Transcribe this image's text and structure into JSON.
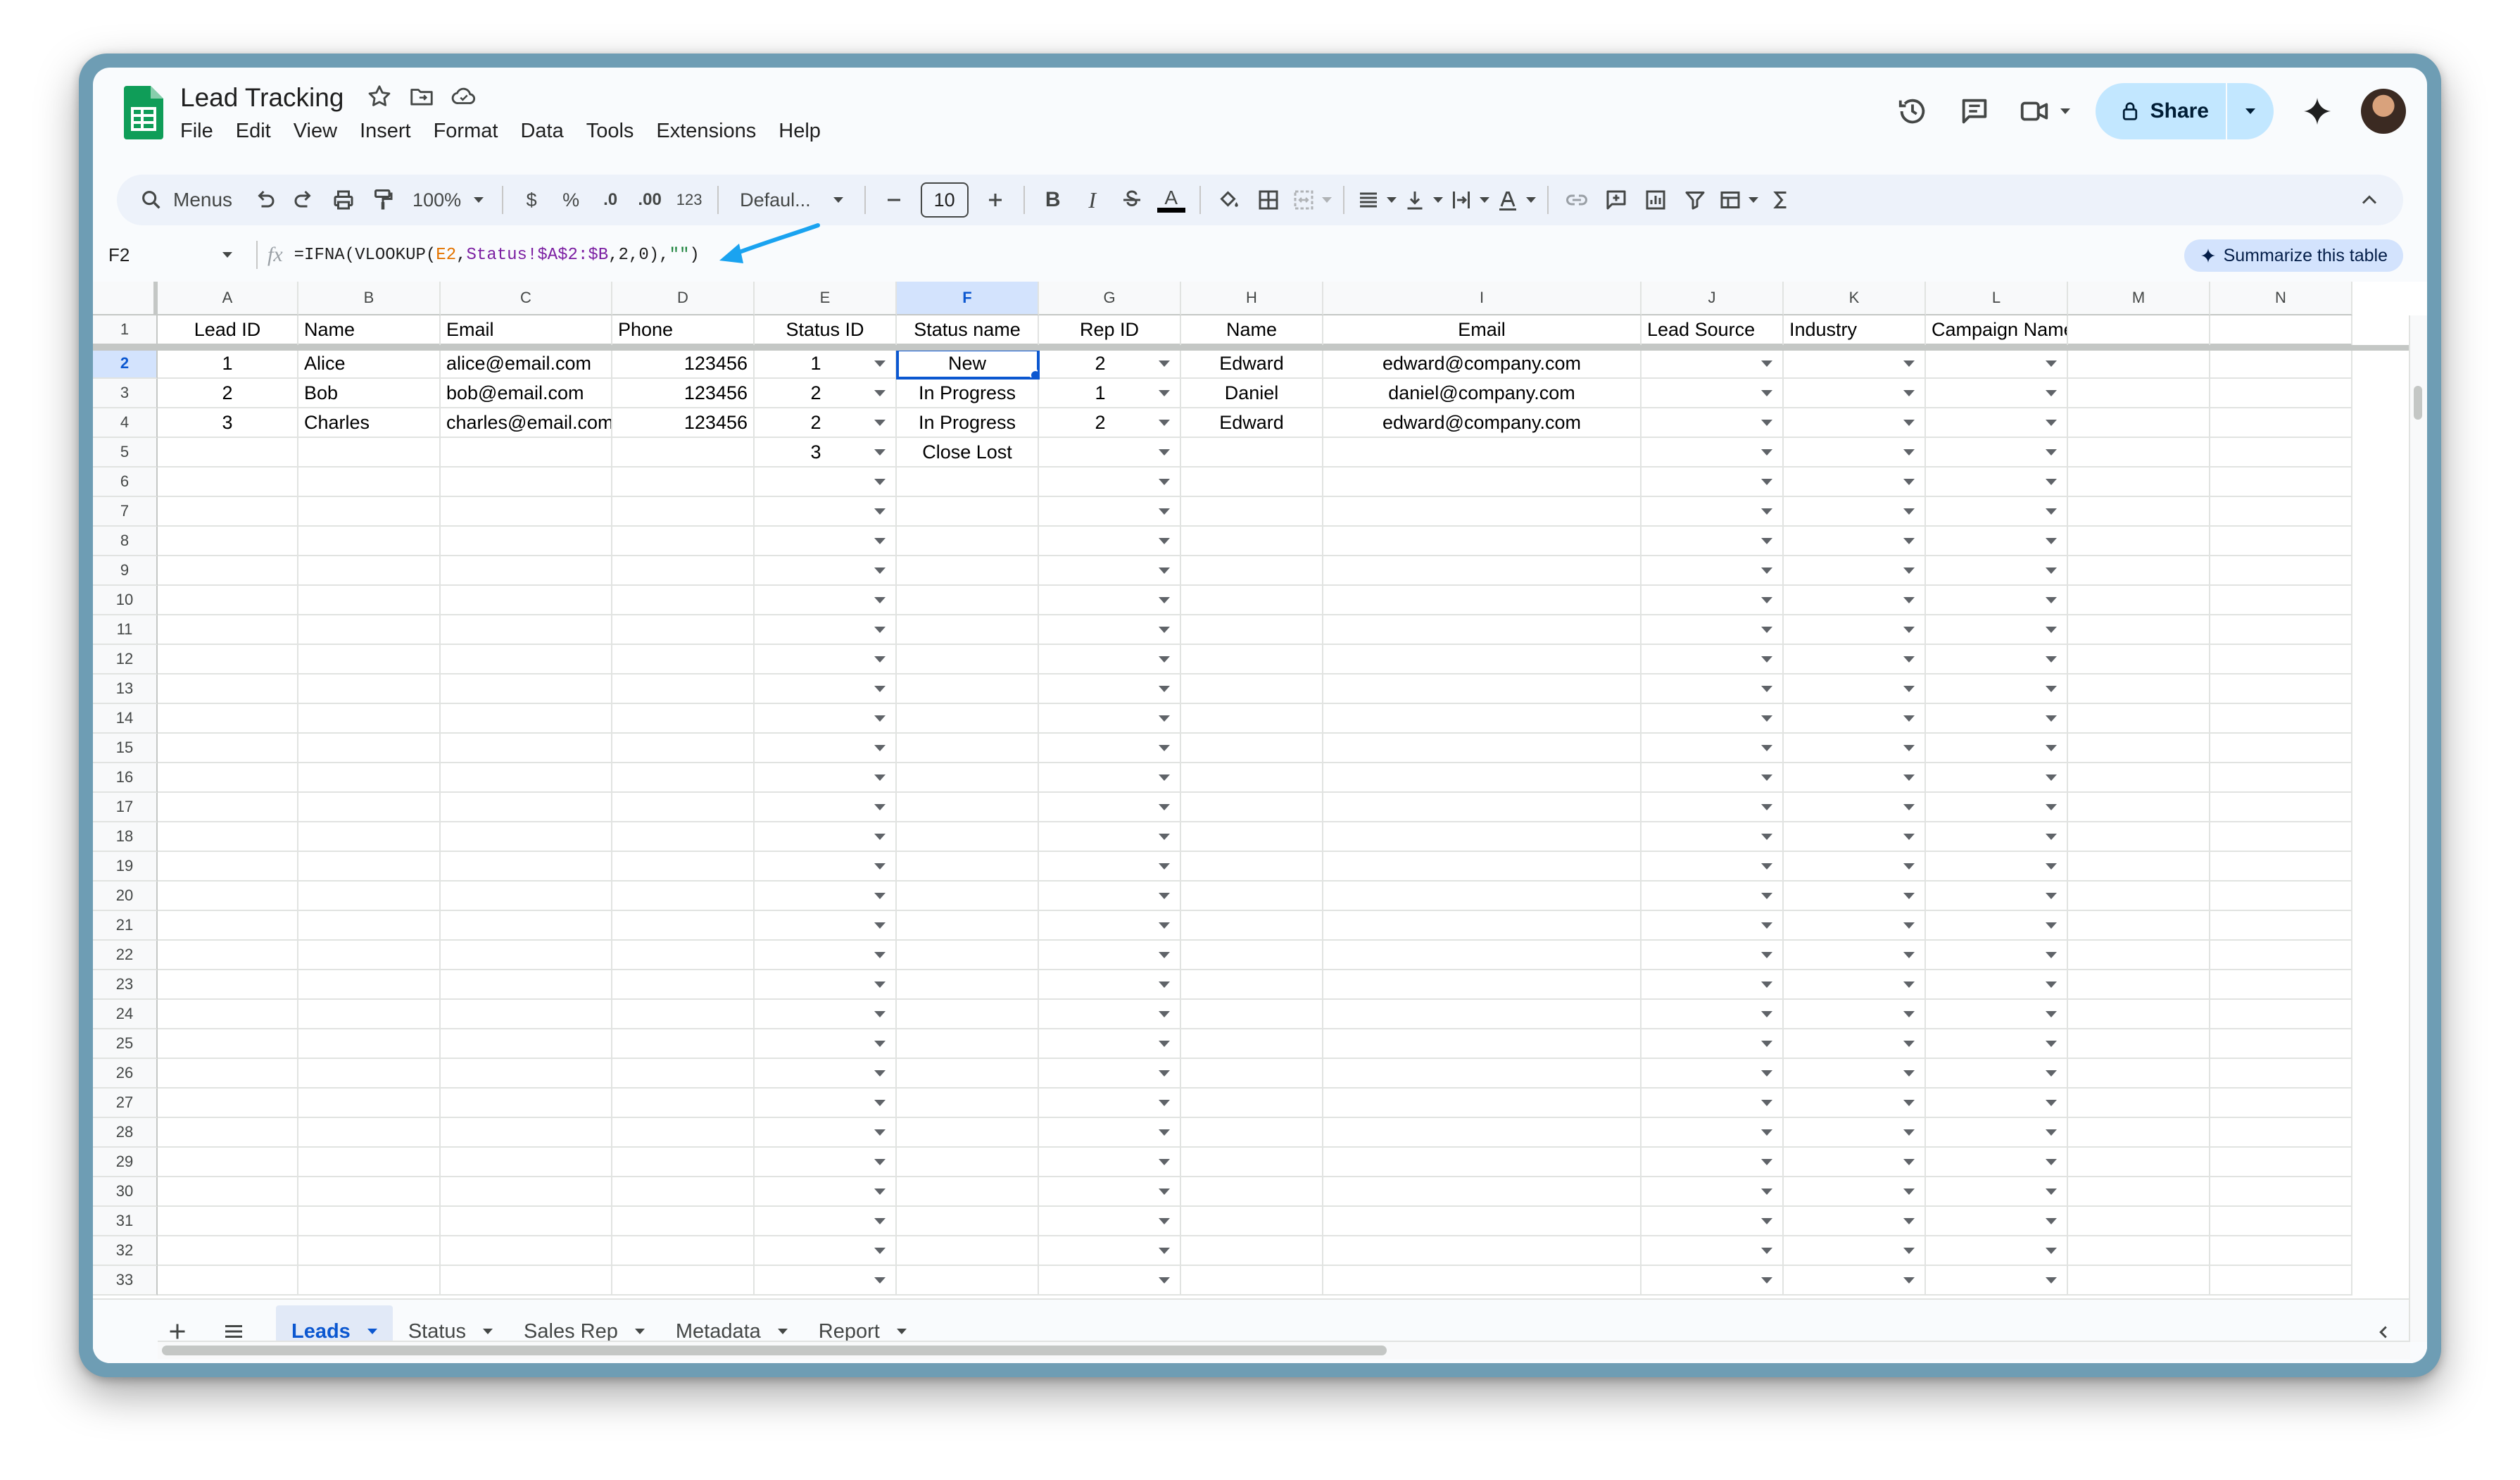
{
  "app": {
    "title": "Lead Tracking",
    "menu": [
      "File",
      "Edit",
      "View",
      "Insert",
      "Format",
      "Data",
      "Tools",
      "Extensions",
      "Help"
    ],
    "share_label": "Share"
  },
  "toolbar": {
    "menus_label": "Menus",
    "zoom": "100%",
    "currency": "$",
    "percent": "%",
    "dec_decrease": ".0",
    "dec_increase": ".00",
    "number_format": "123",
    "font": "Defaul...",
    "font_size": "10",
    "bold": "B",
    "italic": "I",
    "text_color": "A"
  },
  "formula_bar": {
    "cell_ref": "F2",
    "formula_parts": [
      "=IFNA(VLOOKUP(",
      "E2",
      ",",
      "Status!$A$2:$B",
      ",2,0),",
      "\"\"",
      ")"
    ],
    "summarize_label": "Summarize this table"
  },
  "grid": {
    "columns": [
      "A",
      "B",
      "C",
      "D",
      "E",
      "F",
      "G",
      "H",
      "I",
      "J",
      "K",
      "L",
      "M",
      "N"
    ],
    "row_numbers": [
      "1",
      "2",
      "3",
      "4",
      "5",
      "6",
      "7",
      "8",
      "9",
      "10",
      "11",
      "12",
      "13",
      "14",
      "15",
      "16",
      "17",
      "18",
      "19",
      "20",
      "21",
      "22",
      "23",
      "24",
      "25",
      "26",
      "27",
      "28",
      "29",
      "30",
      "31",
      "32",
      "33"
    ],
    "headers": [
      "Lead ID",
      "Name",
      "Email",
      "Phone",
      "Status ID",
      "Status name",
      "Rep ID",
      "Name",
      "Email",
      "Lead Source",
      "Industry",
      "Campaign Names",
      "",
      ""
    ],
    "rows": [
      [
        "1",
        "Alice",
        "alice@email.com",
        "123456",
        "1",
        "New",
        "2",
        "Edward",
        "edward@company.com",
        "",
        "",
        "",
        "",
        ""
      ],
      [
        "2",
        "Bob",
        "bob@email.com",
        "123456",
        "2",
        "In Progress",
        "1",
        "Daniel",
        "daniel@company.com",
        "",
        "",
        "",
        "",
        ""
      ],
      [
        "3",
        "Charles",
        "charles@email.com",
        "123456",
        "2",
        "In Progress",
        "2",
        "Edward",
        "edward@company.com",
        "",
        "",
        "",
        "",
        ""
      ],
      [
        "",
        "",
        "",
        "",
        "3",
        "Close Lost",
        "",
        "",
        "",
        "",
        "",
        "",
        "",
        ""
      ]
    ],
    "selected_cell": "F2"
  },
  "sheets": {
    "tabs": [
      "Leads",
      "Status",
      "Sales Rep",
      "Metadata",
      "Report"
    ],
    "active": "Leads"
  },
  "colors": {
    "accent": "#0b57d0",
    "share_bg": "#c2e7ff",
    "annotation_arrow": "#1aa3f0",
    "sheets_green": "#0f9d58"
  }
}
